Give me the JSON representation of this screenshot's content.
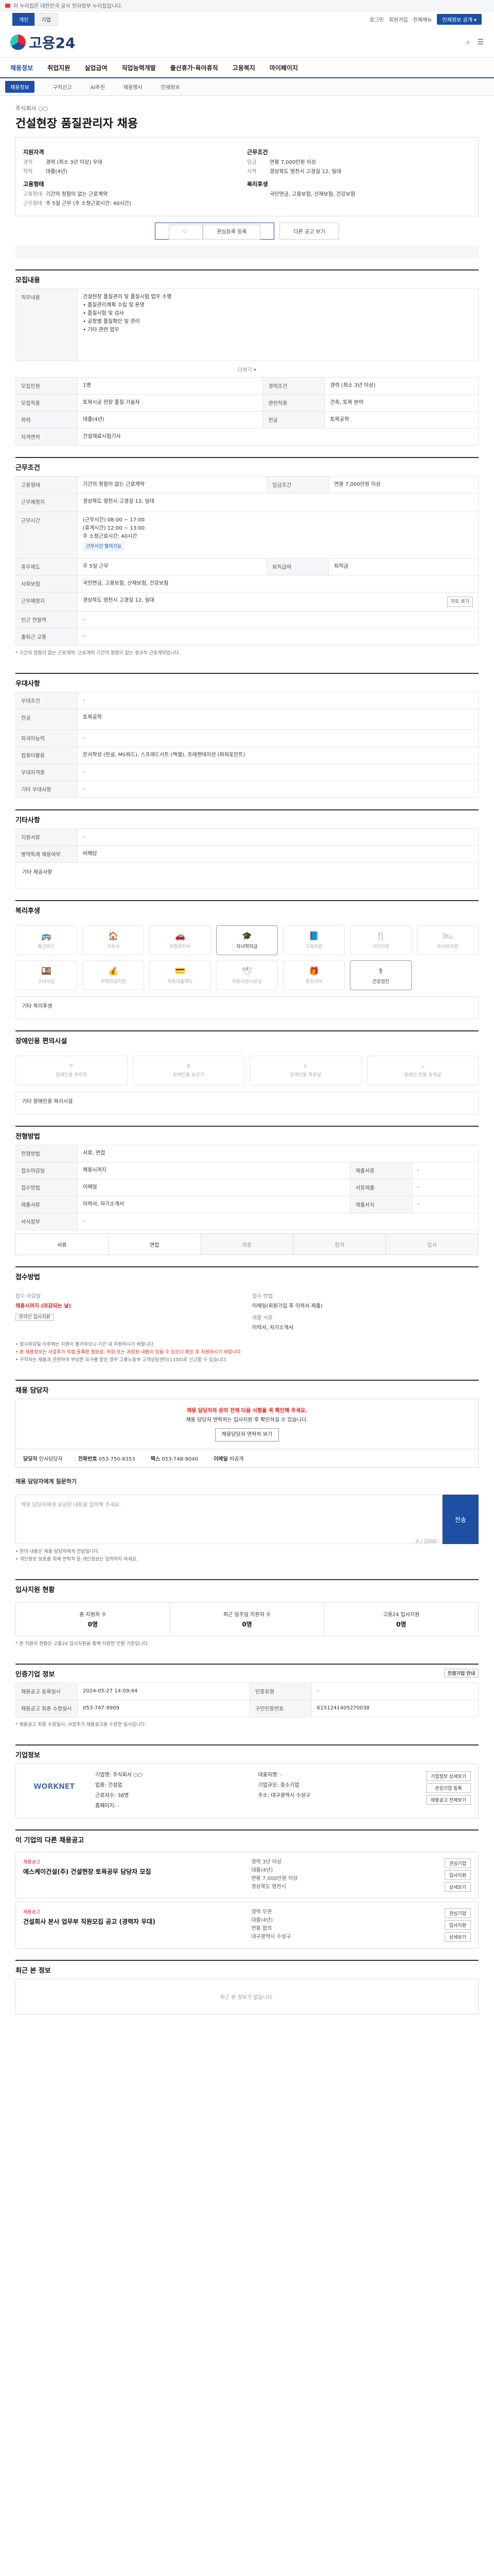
{
  "topbar": {
    "notice": "이 누리집은 대한민국 공식 전자정부 누리집입니다."
  },
  "util": {
    "tabs": [
      "개인",
      "기업"
    ],
    "links": [
      "로그인",
      "회원가입",
      "전체메뉴"
    ],
    "cta": "인재정보 공개 ▾"
  },
  "header": {
    "logo": "고용24",
    "sub": ""
  },
  "gnb": [
    "채용정보",
    "취업지원",
    "실업급여",
    "직업능력개발",
    "출산휴가·육아휴직",
    "고용복지",
    "마이페이지"
  ],
  "snb": [
    "채용정보",
    "구직신고",
    "AI추천",
    "채용행사",
    "인재정보"
  ],
  "job": {
    "company": "주식회사 ○○",
    "title": "건설현장 품질관리자 채용",
    "summary_left_title": "지원자격",
    "summary_left": [
      {
        "k": "경력",
        "v": "경력 (최소 3년 이상) 우대"
      },
      {
        "k": "학력",
        "v": "대졸(4년)"
      }
    ],
    "summary_left2_title": "고용형태",
    "summary_left2": [
      {
        "k": "고용형태",
        "v": "기간의 정함이 없는 근로계약"
      },
      {
        "k": "근무형태",
        "v": "주 5일 근무 (주 소정근로시간: 40시간)"
      }
    ],
    "summary_right_title": "근무조건",
    "summary_right": [
      {
        "k": "임금",
        "v": "연봉 7,000만원 이상"
      },
      {
        "k": "지역",
        "v": "경상북도 영천시 고경길 12, 일대"
      }
    ],
    "summary_right2_title": "복리후생",
    "summary_right2": [
      {
        "k": "",
        "v": "국민연금, 고용보험, 산재보험, 건강보험"
      }
    ],
    "btn_interest": "관심등록 등록",
    "btn_share": "다른 공고 보기",
    "btn_print": "인쇄하기"
  },
  "section_titles": {
    "recruit": "모집내용",
    "conditions": "근무조건",
    "prefer": "우대사항",
    "etc": "기타사항",
    "welfare": "복리후생",
    "disability": "장애인용 편의시설",
    "process": "전형방법",
    "apply": "접수방법",
    "manager": "채용 담당자",
    "stats": "입사지원 현황",
    "company": "기업정보",
    "related": "이 기업의 다른 채용공고",
    "recent": "최근 본 정보"
  },
  "recruit": {
    "duty_label": "직무내용",
    "duty_text": "건설현장 품질관리 및 품질시험 업무 수행\n• 품질관리계획 수립 및 운영\n• 품질시험 및 검사\n• 공정별 품질확인 및 관리\n• 기타 관련 업무",
    "more": "더보기 ▾",
    "rows": [
      {
        "k": "모집인원",
        "v": "1명",
        "k2": "경력조건",
        "v2": "경력 (최소 3년 이상)"
      },
      {
        "k": "모집직종",
        "v": "토목시공 현장 품질 기술자",
        "k2": "관련직종",
        "v2": "건축, 토목 분야"
      },
      {
        "k": "학력",
        "v": "대졸(4년)",
        "k2": "전공",
        "v2": "토목공학"
      },
      {
        "k": "자격면허",
        "v": "건설재료시험기사",
        "k2": "",
        "v2": ""
      }
    ]
  },
  "conditions": {
    "rows": [
      {
        "k": "고용형태",
        "v": "기간의 정함이 없는 근로계약",
        "k2": "임금조건",
        "v2": "연봉 7,000만원 이상"
      },
      {
        "k": "근무예정지",
        "v": "경상북도 영천시 고경길 12, 일대",
        "k2": "",
        "v2": ""
      },
      {
        "k": "근무시간",
        "v": "(근무시간) 08:00 ~ 17:00\n(휴게시간) 12:00 ~ 13:00\n주 소정근로시간: 40시간",
        "k2": "",
        "v2": "",
        "pill": "근무시간 협의가능"
      },
      {
        "k": "휴무제도",
        "v": "주 5일 근무",
        "k2": "퇴직급여",
        "v2": "퇴직금"
      },
      {
        "k": "사회보험",
        "v": "국민연금, 고용보험, 산재보험, 건강보험",
        "k2": "",
        "v2": ""
      },
      {
        "k": "근무예정지",
        "v": "경상북도 영천시 고경길 12, 일대",
        "k2": "",
        "v2": "",
        "btn": "지도 보기"
      },
      {
        "k": "인근 전철역",
        "v": "-",
        "k2": "",
        "v2": ""
      },
      {
        "k": "출퇴근 교통",
        "v": "-",
        "k2": "",
        "v2": ""
      }
    ],
    "note": "* 기간의 정함이 없는 근로계약: 근로계약 기간의 정함이 없는 정규직 근로계약입니다."
  },
  "prefer": {
    "rows": [
      {
        "k": "우대조건",
        "v": "-"
      },
      {
        "k": "전공",
        "v": "토목공학"
      },
      {
        "k": "외국어능력",
        "v": "-"
      },
      {
        "k": "컴퓨터활용",
        "v": "문서작성 (한글, MS워드), 스프레드시트 (엑셀), 프레젠테이션 (파워포인트)"
      },
      {
        "k": "우대자격증",
        "v": "-"
      },
      {
        "k": "기타 우대사항",
        "v": "-"
      }
    ]
  },
  "etc": {
    "rows": [
      {
        "k": "지원서류",
        "v": "-"
      },
      {
        "k": "병역특례 채용여부",
        "v": "비해당"
      }
    ],
    "more": "기타 제공사항"
  },
  "welfare": [
    "통근버스",
    "기숙사",
    "차량유지비",
    "자녀학자금",
    "교육지원",
    "식비지원",
    "숙식비지원",
    "구내식당",
    "주택자금지원",
    "직원대출제도",
    "직원사망시보상",
    "경조사비",
    "건강검진"
  ],
  "welfare_on": [
    3,
    12
  ],
  "welfare_note": "기타 복리후생",
  "disability": [
    "장애인용 주차장",
    "장애인용 승강기",
    "장애인용 화장실",
    "장애인 전용 휴게실"
  ],
  "disability_note": "기타 장애인용 복리시설",
  "process": {
    "rows": [
      {
        "k": "전형방법",
        "v": "서류, 면접"
      },
      {
        "k": "접수마감일",
        "v": "채용시까지",
        "k2": "제출서류",
        "v2": "-"
      },
      {
        "k": "접수방법",
        "v": "이메일",
        "k2": "서류제출",
        "v2": "-"
      },
      {
        "k": "제출서류",
        "v": "이력서, 자기소개서",
        "k2": "제출서식",
        "v2": "-"
      },
      {
        "k": "서식첨부",
        "v": "-",
        "k2": "",
        "v2": ""
      }
    ],
    "steps": [
      "서류",
      "면접",
      "최종",
      "합격",
      "입사"
    ]
  },
  "apply": {
    "left_label": "접수 마감일",
    "left_value": "채용시까지 (마감되는 날)",
    "left_btn": "온라인 입사지원",
    "right_label": "접수 방법",
    "right_value": "이메일(회원가입 후 이력서 제출)",
    "right_label2": "제출 서류",
    "right_value2": "이력서, 자기소개서",
    "notes": [
      "• 접수마감일 이후에는 지원이 불가하오니 기간 내 지원하시기 바랍니다.",
      "• 본 채용정보는 사업주가 직접 등록한 정보로, 허위 또는 과장된 내용이 있을 수 있으니 확인 후 지원하시기 바랍니다.",
      "• 구직자는 채용과 관련하여 부당한 요구를 받은 경우 고용노동부 고객상담센터(1350)로 신고할 수 있습니다."
    ]
  },
  "manager": {
    "title": "채용 담당자와 문의 전에 다음 사항을 꼭 확인해 주세요.",
    "desc": "채용 담당자 연락처는 입사지원 후 확인하실 수 있습니다.",
    "btn": "채용담당자 연락처 보기",
    "name_label": "담당자",
    "name_value": "인사담당자",
    "phone_label": "전화번호",
    "phone_value": "053-750-8353",
    "fax_label": "팩스",
    "fax_value": "053-748-9040",
    "email_label": "이메일",
    "email_value": "비공개"
  },
  "inquiry": {
    "label": "채용 담당자에게 질문하기",
    "placeholder": "채용 담당자에게 궁금한 내용을 입력해 주세요.",
    "counter": "0 / 2000",
    "send": "전송",
    "notes": [
      "• 문의 내용은 채용 담당자에게 전달됩니다.",
      "• 개인정보 보호를 위해 연락처 등 개인정보는 입력하지 마세요."
    ]
  },
  "stats": [
    {
      "label": "총 지원자 수",
      "value": "0명"
    },
    {
      "label": "최근 일주일 지원자 수",
      "value": "0명"
    },
    {
      "label": "고용24 입사지원",
      "value": "0명"
    }
  ],
  "stats_note": "* 본 지원자 현황은 고용24 입사지원을 통해 지원한 인원 기준입니다.",
  "history": {
    "title": "인증기업 정보",
    "btn": "인증기업 안내",
    "rows": [
      {
        "k": "채용공고 등록일시",
        "v": "2024-05-27 14:09:44",
        "k2": "인증유형",
        "v2": "-"
      },
      {
        "k": "채용공고 최종 수정일시",
        "v": "053-747-9909",
        "k2": "구인인증번호",
        "v2": "K151241405270038"
      }
    ],
    "note": "* 채용공고 최종 수정일시: 사업주가 채용공고를 수정한 일시입니다."
  },
  "company": {
    "logo": "WORKNET",
    "name_label": "기업명",
    "name": "주식회사 ○○",
    "ceo_label": "대표자명",
    "ceo": "-",
    "biz_label": "업종",
    "biz": "건설업",
    "size_label": "기업규모",
    "size": "중소기업",
    "emp_label": "근로자수",
    "emp": "38명",
    "addr_label": "주소",
    "addr": "대구광역시 수성구",
    "hp_label": "홈페이지",
    "hp": "-",
    "btns": [
      "기업정보 상세보기",
      "관심기업 등록",
      "채용공고 전체보기"
    ]
  },
  "related": [
    {
      "company": "채용공고",
      "title": "에스케이건설(주) 건설현장 토목공무 담당자 모집",
      "meta": [
        "경력 3년 이상",
        "대졸(4년)",
        "연봉 7,000만원 이상",
        "경상북도 영천시"
      ],
      "btns": [
        "관심기업",
        "입사지원",
        "상세보기"
      ]
    },
    {
      "company": "채용공고",
      "title": "건설회사 본사 업무부 직원모집 공고 (경력자 우대)",
      "meta": [
        "경력 무관",
        "대졸(4년)",
        "연봉 협의",
        "대구광역시 수성구"
      ],
      "btns": [
        "관심기업",
        "입사지원",
        "상세보기"
      ]
    }
  ],
  "recent": {
    "empty": "최근 본 정보가 없습니다."
  },
  "icons": {
    "search": "search-icon",
    "menu": "menu-icon",
    "bookmark": "bookmark-icon"
  },
  "colors": {
    "brand": "#1d4fa3",
    "alert": "#d22222"
  }
}
